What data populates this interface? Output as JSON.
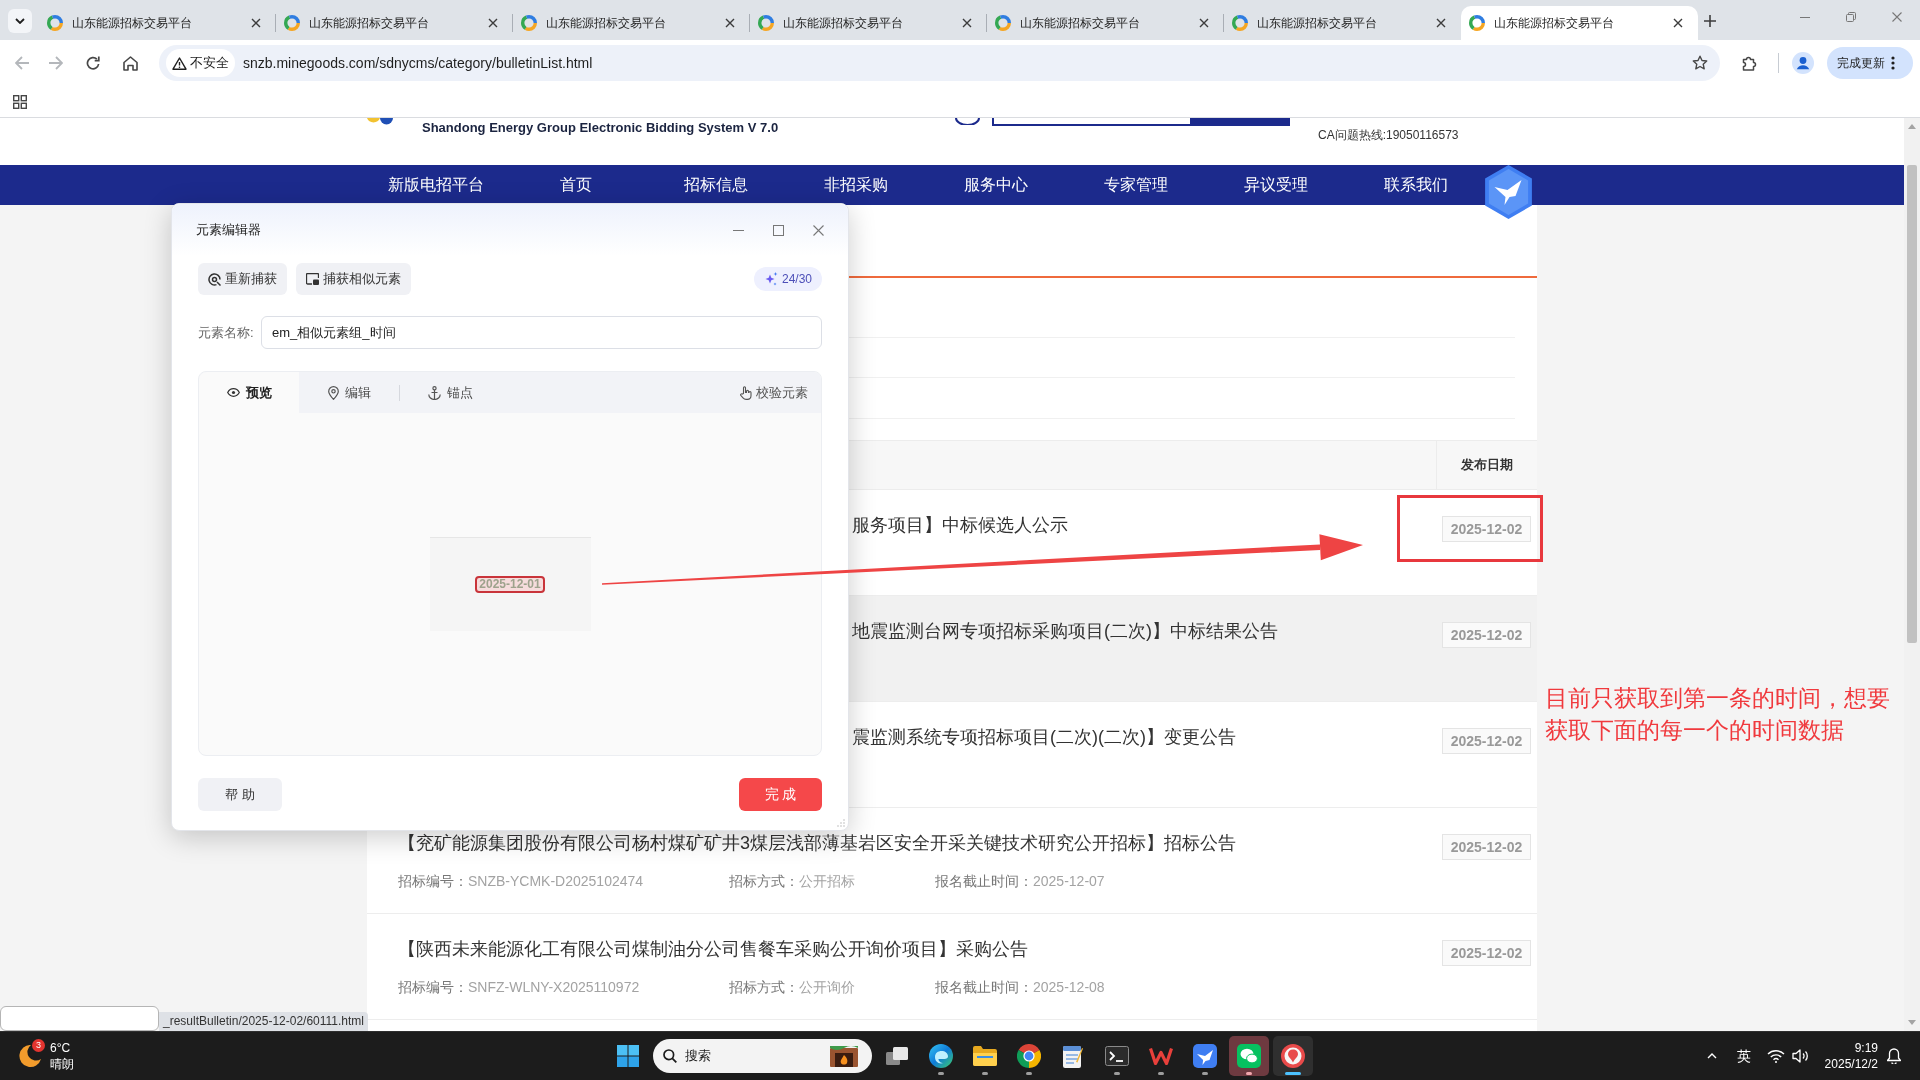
{
  "browser": {
    "tabs": [
      {
        "title": "山东能源招标交易平台",
        "selected": false
      },
      {
        "title": "山东能源招标交易平台",
        "selected": false
      },
      {
        "title": "山东能源招标交易平台",
        "selected": false
      },
      {
        "title": "山东能源招标交易平台",
        "selected": false
      },
      {
        "title": "山东能源招标交易平台",
        "selected": false
      },
      {
        "title": "山东能源招标交易平台",
        "selected": false
      },
      {
        "title": "山东能源招标交易平台",
        "selected": true
      }
    ],
    "back_enabled": false,
    "forward_enabled": false,
    "security_label": "不安全",
    "url": "snzb.minegoods.com/sdnycms/category/bulletinList.html",
    "update_button": "完成更新"
  },
  "site_header": {
    "subtitle": "Shandong Energy Group Electronic Bidding System V 7.0",
    "hotline": "CA问题热线:19050116573"
  },
  "nav": {
    "items": [
      "新版电招平台",
      "首页",
      "招标信息",
      "非招采购",
      "服务中心",
      "专家管理",
      "异议受理",
      "联系我们"
    ]
  },
  "bulletins": {
    "date_column": "发布日期",
    "rows": [
      {
        "title": "服务项目】中标候选人公示",
        "highlighted": false,
        "date": "2025-12-02"
      },
      {
        "title": "地震监测台网专项招标采购项目(二次)】中标结果公告",
        "highlighted": true,
        "date": "2025-12-02"
      },
      {
        "title": "震监测系统专项招标项目(二次)(二次)】变更公告",
        "highlighted": false,
        "date": "2025-12-02"
      },
      {
        "title": "【兖矿能源集团股份有限公司杨村煤矿矿井3煤层浅部薄基岩区安全开采关键技术研究公开招标】招标公告",
        "highlighted": false,
        "meta": [
          {
            "label": "招标编号：",
            "value": "SNZB-YCMK-D2025102474"
          },
          {
            "label": "招标方式：",
            "value": "公开招标"
          },
          {
            "label": "报名截止时间：",
            "value": "2025-12-07"
          }
        ],
        "date": "2025-12-02"
      },
      {
        "title": "【陕西未来能源化工有限公司煤制油分公司售餐车采购公开询价项目】采购公告",
        "highlighted": false,
        "meta": [
          {
            "label": "招标编号：",
            "value": "SNFZ-WLNY-X2025110972"
          },
          {
            "label": "招标方式：",
            "value": "公开询价"
          },
          {
            "label": "报名截止时间：",
            "value": "2025-12-08"
          }
        ],
        "date": "2025-12-02"
      }
    ]
  },
  "dialog": {
    "title": "元素编辑器",
    "actions": [
      "重新捕获",
      "捕获相似元素"
    ],
    "quota": "24/30",
    "name_label": "元素名称:",
    "name_value": "em_相似元素组_时间",
    "tabs": [
      {
        "label": "预览",
        "selected": true
      },
      {
        "label": "编辑",
        "selected": false
      },
      {
        "label": "锚点",
        "selected": false
      }
    ],
    "verify_button": "校验元素",
    "captured_text": "2025-12-01",
    "help_button": "帮 助",
    "done_button": "完 成"
  },
  "annotation": {
    "note": "目前只获取到第一条的时间，想要获取下面的每一个的时间数据"
  },
  "status_url": "_resultBulletin/2025-12-02/60111.html",
  "taskbar": {
    "weather": {
      "badge": "3",
      "temperature": "6°C",
      "condition": "晴朗"
    },
    "search_label": "搜索",
    "apps": [
      {
        "running": false,
        "active": false,
        "highlighted": false
      },
      {
        "running": true,
        "active": false,
        "highlighted": false
      },
      {
        "running": true,
        "active": false,
        "highlighted": false
      },
      {
        "running": true,
        "active": false,
        "highlighted": false
      },
      {
        "running": false,
        "active": false,
        "highlighted": false
      },
      {
        "running": true,
        "active": false,
        "highlighted": false
      },
      {
        "running": true,
        "active": false,
        "highlighted": false
      },
      {
        "running": true,
        "active": false,
        "highlighted": false
      },
      {
        "running": true,
        "active": false,
        "highlighted": true
      },
      {
        "running": true,
        "active": true,
        "highlighted": false
      }
    ],
    "input_method": "英",
    "time": "9:19",
    "date": "2025/12/2"
  }
}
